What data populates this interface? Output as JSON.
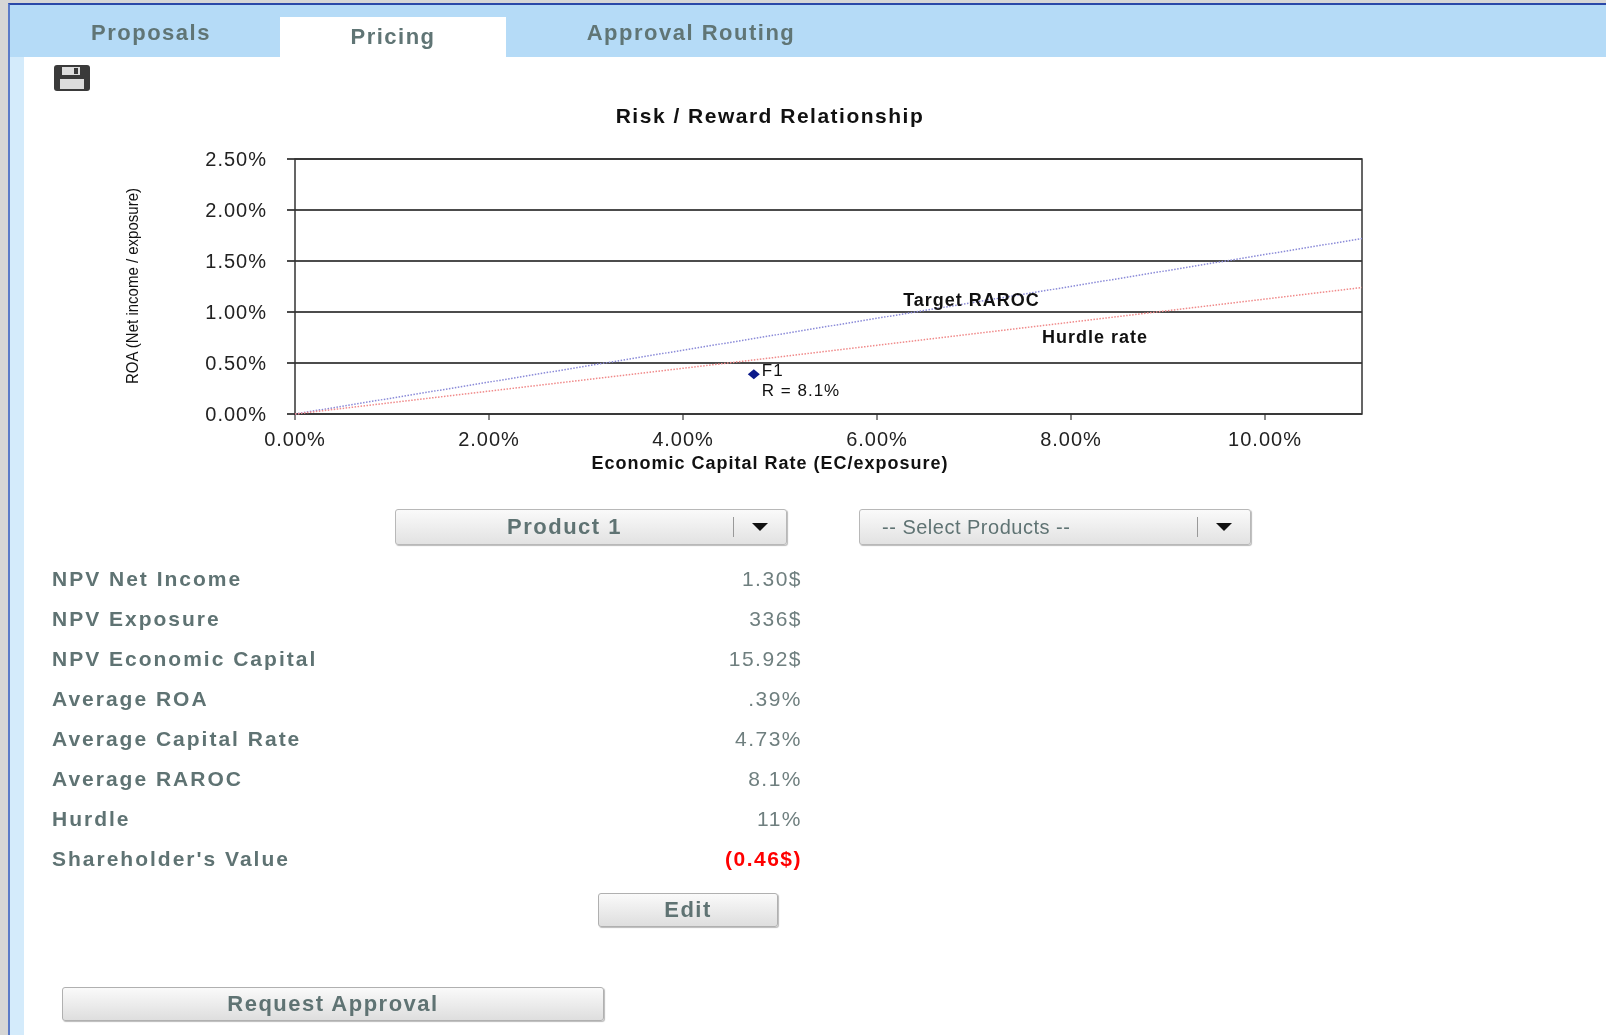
{
  "tabs": [
    {
      "label": "Proposals",
      "selected": false
    },
    {
      "label": "Pricing",
      "selected": true
    },
    {
      "label": "Approval Routing",
      "selected": false
    }
  ],
  "chart": {
    "chart_data": {
      "type": "line",
      "title": "Risk / Reward Relationship",
      "xlabel": "Economic Capital Rate (EC/exposure)",
      "ylabel": "ROA (Net income / exposure)",
      "x": [
        0,
        4.73,
        11
      ],
      "series": [
        {
          "name": "Target RAROC",
          "color": "#8a8ad8",
          "line_style": "dotted",
          "values": [
            0,
            0.74,
            1.72
          ]
        },
        {
          "name": "Hurdle rate",
          "color": "#f08a8a",
          "line_style": "dotted",
          "values": [
            0,
            0.53,
            1.24
          ]
        },
        {
          "name": "F1",
          "color": "#0b1a8a",
          "marker": "diamond",
          "values": [
            null,
            0.39,
            null
          ]
        }
      ],
      "grid": true,
      "xlim": [
        0,
        11
      ],
      "ylim": [
        0,
        2.5
      ],
      "xticks": [
        {
          "value": 0,
          "label": "0.00%"
        },
        {
          "value": 2,
          "label": "2.00%"
        },
        {
          "value": 4,
          "label": "4.00%"
        },
        {
          "value": 6,
          "label": "6.00%"
        },
        {
          "value": 8,
          "label": "8.00%"
        },
        {
          "value": 10,
          "label": "10.00%"
        }
      ],
      "yticks": [
        {
          "value": 0,
          "label": "0.00%"
        },
        {
          "value": 0.5,
          "label": "0.50%"
        },
        {
          "value": 1,
          "label": "1.00%"
        },
        {
          "value": 1.5,
          "label": "1.50%"
        },
        {
          "value": 2,
          "label": "2.00%"
        },
        {
          "value": 2.5,
          "label": "2.50%"
        }
      ],
      "annotations": [
        "R = 8.1%"
      ]
    }
  },
  "dropdowns": [
    {
      "value": "Product 1"
    },
    {
      "placeholder": "-- Select Products --"
    }
  ],
  "metrics": [
    {
      "label": "NPV Net Income",
      "value": "1.30$",
      "kind": "plain"
    },
    {
      "label": "NPV Exposure",
      "value": "336$",
      "kind": "plain"
    },
    {
      "label": "NPV Economic Capital",
      "value": "15.92$",
      "kind": "plain"
    },
    {
      "label": "Average ROA",
      "value": ".39%",
      "kind": "plain"
    },
    {
      "label": "Average Capital Rate",
      "value": "4.73%",
      "kind": "plain"
    },
    {
      "label": "Average RAROC",
      "value": "8.1%",
      "kind": "plain"
    },
    {
      "label": "Hurdle",
      "value": "11%",
      "kind": "plain"
    },
    {
      "label": "Shareholder's Value",
      "value": "(0.46$)",
      "kind": "negative"
    }
  ],
  "edit_button": "Edit",
  "request_button": "Request Approval"
}
